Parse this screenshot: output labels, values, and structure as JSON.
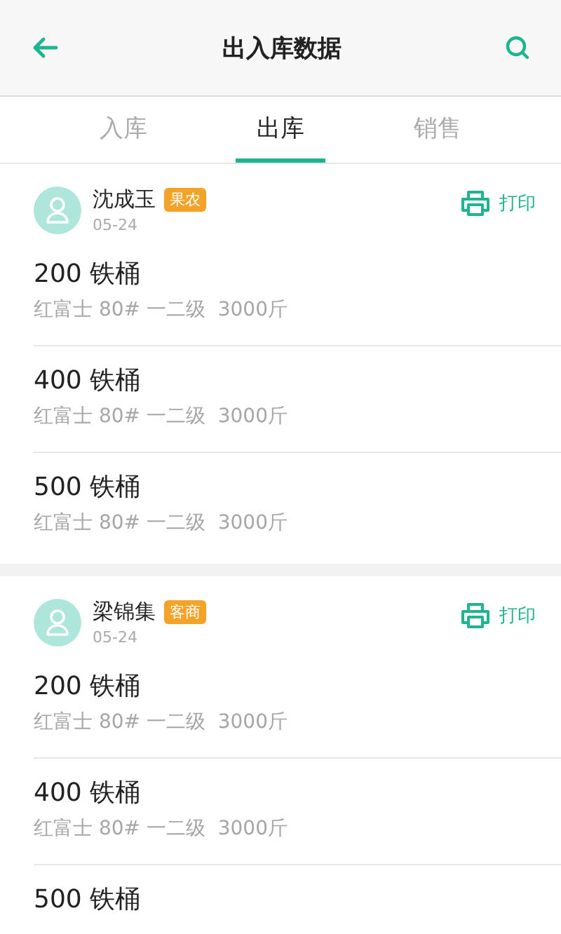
{
  "header": {
    "title": "出入库数据"
  },
  "tabs": [
    {
      "label": "入库",
      "selected": false
    },
    {
      "label": "出库",
      "selected": true
    },
    {
      "label": "销售",
      "selected": false
    }
  ],
  "records": [
    {
      "name": "沈成玉",
      "tag": "果农",
      "date": "05-24",
      "print": "打印",
      "items": [
        {
          "quantity": "200 铁桶",
          "detail": "红富士 80# 一二级  3000斤"
        },
        {
          "quantity": "400 铁桶",
          "detail": "红富士 80# 一二级  3000斤"
        },
        {
          "quantity": "500 铁桶",
          "detail": "红富士 80# 一二级  3000斤"
        }
      ]
    },
    {
      "name": "梁锦集",
      "tag": "客商",
      "date": "05-24",
      "print": "打印",
      "items": [
        {
          "quantity": "200 铁桶",
          "detail": "红富士 80# 一二级  3000斤"
        },
        {
          "quantity": "400 铁桶",
          "detail": "红富士 80# 一二级  3000斤"
        },
        {
          "quantity": "500 铁桶"
        }
      ]
    }
  ]
}
